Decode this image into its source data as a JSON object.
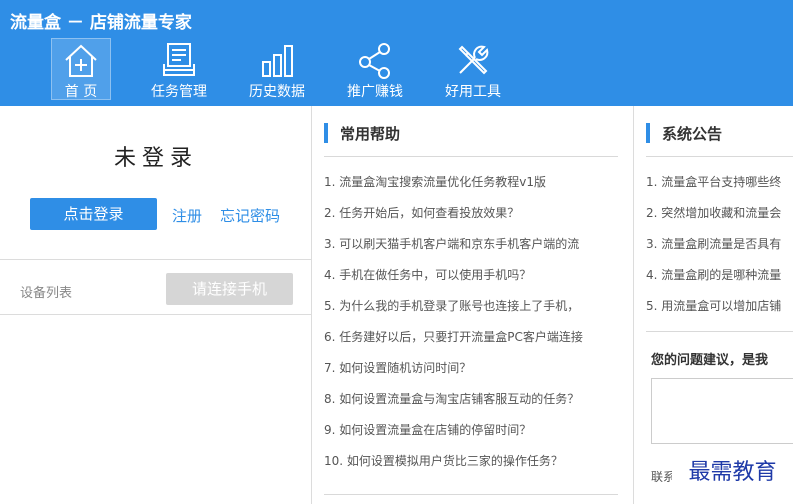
{
  "app": {
    "title": "流量盒 － 店铺流量专家"
  },
  "nav": [
    {
      "label": "首  页",
      "icon": "home-icon",
      "active": true
    },
    {
      "label": "任务管理",
      "icon": "task-list-icon"
    },
    {
      "label": "历史数据",
      "icon": "bar-chart-icon"
    },
    {
      "label": "推广赚钱",
      "icon": "share-icon"
    },
    {
      "label": "好用工具",
      "icon": "tools-icon"
    }
  ],
  "login": {
    "status": "未登录",
    "login_button": "点击登录",
    "register_link": "注册",
    "forgot_link": "忘记密码"
  },
  "devices": {
    "label": "设备列表",
    "connect_button": "请连接手机"
  },
  "help": {
    "title": "常用帮助",
    "items": [
      "1. 流量盒淘宝搜索流量优化任务教程v1版",
      "2. 任务开始后，如何查看投放效果？",
      "3. 可以刷天猫手机客户端和京东手机客户端的流",
      "4. 手机在做任务中，可以使用手机吗？",
      "5. 为什么我的手机登录了账号也连接上了手机，",
      "6. 任务建好以后，只要打开流量盒PC客户端连接",
      "7. 如何设置随机访问时间？",
      "8. 如何设置流量盒与淘宝店铺客服互动的任务？",
      "9. 如何设置流量盒在店铺的停留时间？",
      "10. 如何设置模拟用户货比三家的操作任务？"
    ]
  },
  "notices": {
    "title": "系统公告",
    "items": [
      "1. 流量盒平台支持哪些终",
      "2. 突然增加收藏和流量会",
      "3. 流量盒刷流量是否具有",
      "4. 流量盒刷的是哪种流量",
      "5. 用流量盒可以增加店铺"
    ]
  },
  "feedback": {
    "title": "您的问题建议，是我",
    "contact_label": "联系方式"
  },
  "watermark": "最需教育",
  "colors": {
    "accent": "#2f8ee6",
    "disabled": "#d6d6d6"
  }
}
